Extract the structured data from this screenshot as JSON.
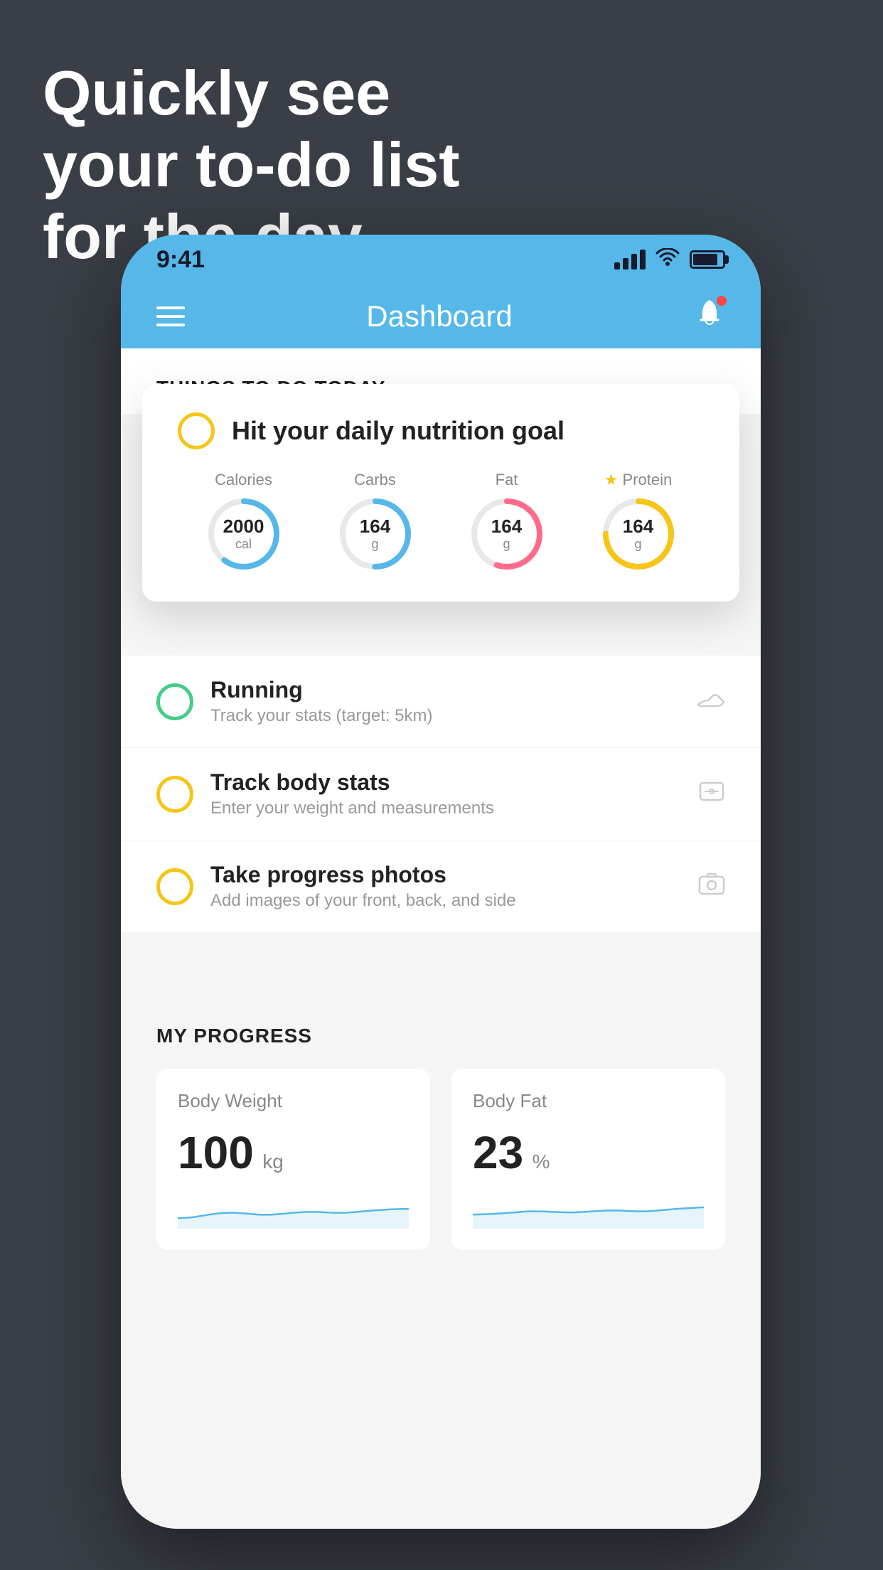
{
  "headline": {
    "line1": "Quickly see",
    "line2": "your to-do list",
    "line3": "for the day."
  },
  "statusBar": {
    "time": "9:41"
  },
  "navBar": {
    "title": "Dashboard"
  },
  "thingsToDo": {
    "sectionTitle": "THINGS TO DO TODAY",
    "floatingCard": {
      "circleColor": "#f5c518",
      "title": "Hit your daily nutrition goal",
      "nutrition": [
        {
          "label": "Calories",
          "value": "2000",
          "unit": "cal",
          "color": "#55b8e8",
          "percent": 60
        },
        {
          "label": "Carbs",
          "value": "164",
          "unit": "g",
          "color": "#55b8e8",
          "percent": 50
        },
        {
          "label": "Fat",
          "value": "164",
          "unit": "g",
          "color": "#ff6b8a",
          "percent": 55
        },
        {
          "label": "Protein",
          "value": "164",
          "unit": "g",
          "color": "#f5c518",
          "percent": 75,
          "starred": true
        }
      ]
    },
    "items": [
      {
        "id": "running",
        "title": "Running",
        "subtitle": "Track your stats (target: 5km)",
        "circleColor": "#44cc88",
        "icon": "shoe"
      },
      {
        "id": "track-body-stats",
        "title": "Track body stats",
        "subtitle": "Enter your weight and measurements",
        "circleColor": "#f5c518",
        "icon": "scale"
      },
      {
        "id": "progress-photos",
        "title": "Take progress photos",
        "subtitle": "Add images of your front, back, and side",
        "circleColor": "#f5c518",
        "icon": "photo"
      }
    ]
  },
  "myProgress": {
    "sectionTitle": "MY PROGRESS",
    "cards": [
      {
        "id": "body-weight",
        "title": "Body Weight",
        "value": "100",
        "unit": "kg"
      },
      {
        "id": "body-fat",
        "title": "Body Fat",
        "value": "23",
        "unit": "%"
      }
    ]
  }
}
